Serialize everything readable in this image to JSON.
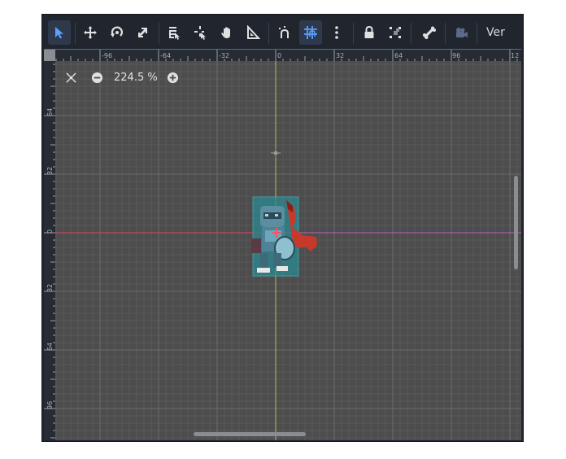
{
  "toolbar": {
    "tools": [
      {
        "name": "select-mode-button",
        "icon": "arrow-pointer-icon",
        "active": true
      },
      {
        "name": "move-mode-button",
        "icon": "move-arrows-icon",
        "active": false
      },
      {
        "name": "rotate-mode-button",
        "icon": "rotate-icon",
        "active": false
      },
      {
        "name": "scale-mode-button",
        "icon": "scale-icon",
        "active": false
      },
      {
        "name": "list-select-button",
        "icon": "list-select-icon",
        "active": false
      },
      {
        "name": "pivot-mode-button",
        "icon": "pivot-icon",
        "active": false
      },
      {
        "name": "pan-mode-button",
        "icon": "hand-icon",
        "active": false
      },
      {
        "name": "ruler-mode-button",
        "icon": "ruler-icon",
        "active": false
      },
      {
        "name": "smart-snap-button",
        "icon": "magnet-snap-icon",
        "active": false
      },
      {
        "name": "grid-snap-button",
        "icon": "grid-snap-icon",
        "active": true
      },
      {
        "name": "snap-options-button",
        "icon": "vertical-dots-icon",
        "active": false
      },
      {
        "name": "lock-button",
        "icon": "lock-icon",
        "active": false
      },
      {
        "name": "group-button",
        "icon": "group-icon",
        "active": false
      },
      {
        "name": "skeleton-button",
        "icon": "bone-icon",
        "active": false
      },
      {
        "name": "camera-button",
        "icon": "camera-icon",
        "active": false
      }
    ],
    "view_label": "Ver"
  },
  "zoom": {
    "value": "224.5 %",
    "reset_icon": "zoom-reset-icon",
    "minus_icon": "zoom-out-icon",
    "plus_icon": "zoom-in-icon"
  },
  "ruler": {
    "top_labels": [
      "-96",
      "-64",
      "-32",
      "0",
      "32",
      "64",
      "96",
      "12"
    ],
    "left_labels": [
      "64",
      "32",
      "0",
      "32",
      "64",
      "96"
    ]
  },
  "colors": {
    "x_axis": "#e0445a",
    "y_axis": "#a8c84a",
    "grid_bg": "#4d4d4d",
    "accent": "#4e8fdc"
  }
}
